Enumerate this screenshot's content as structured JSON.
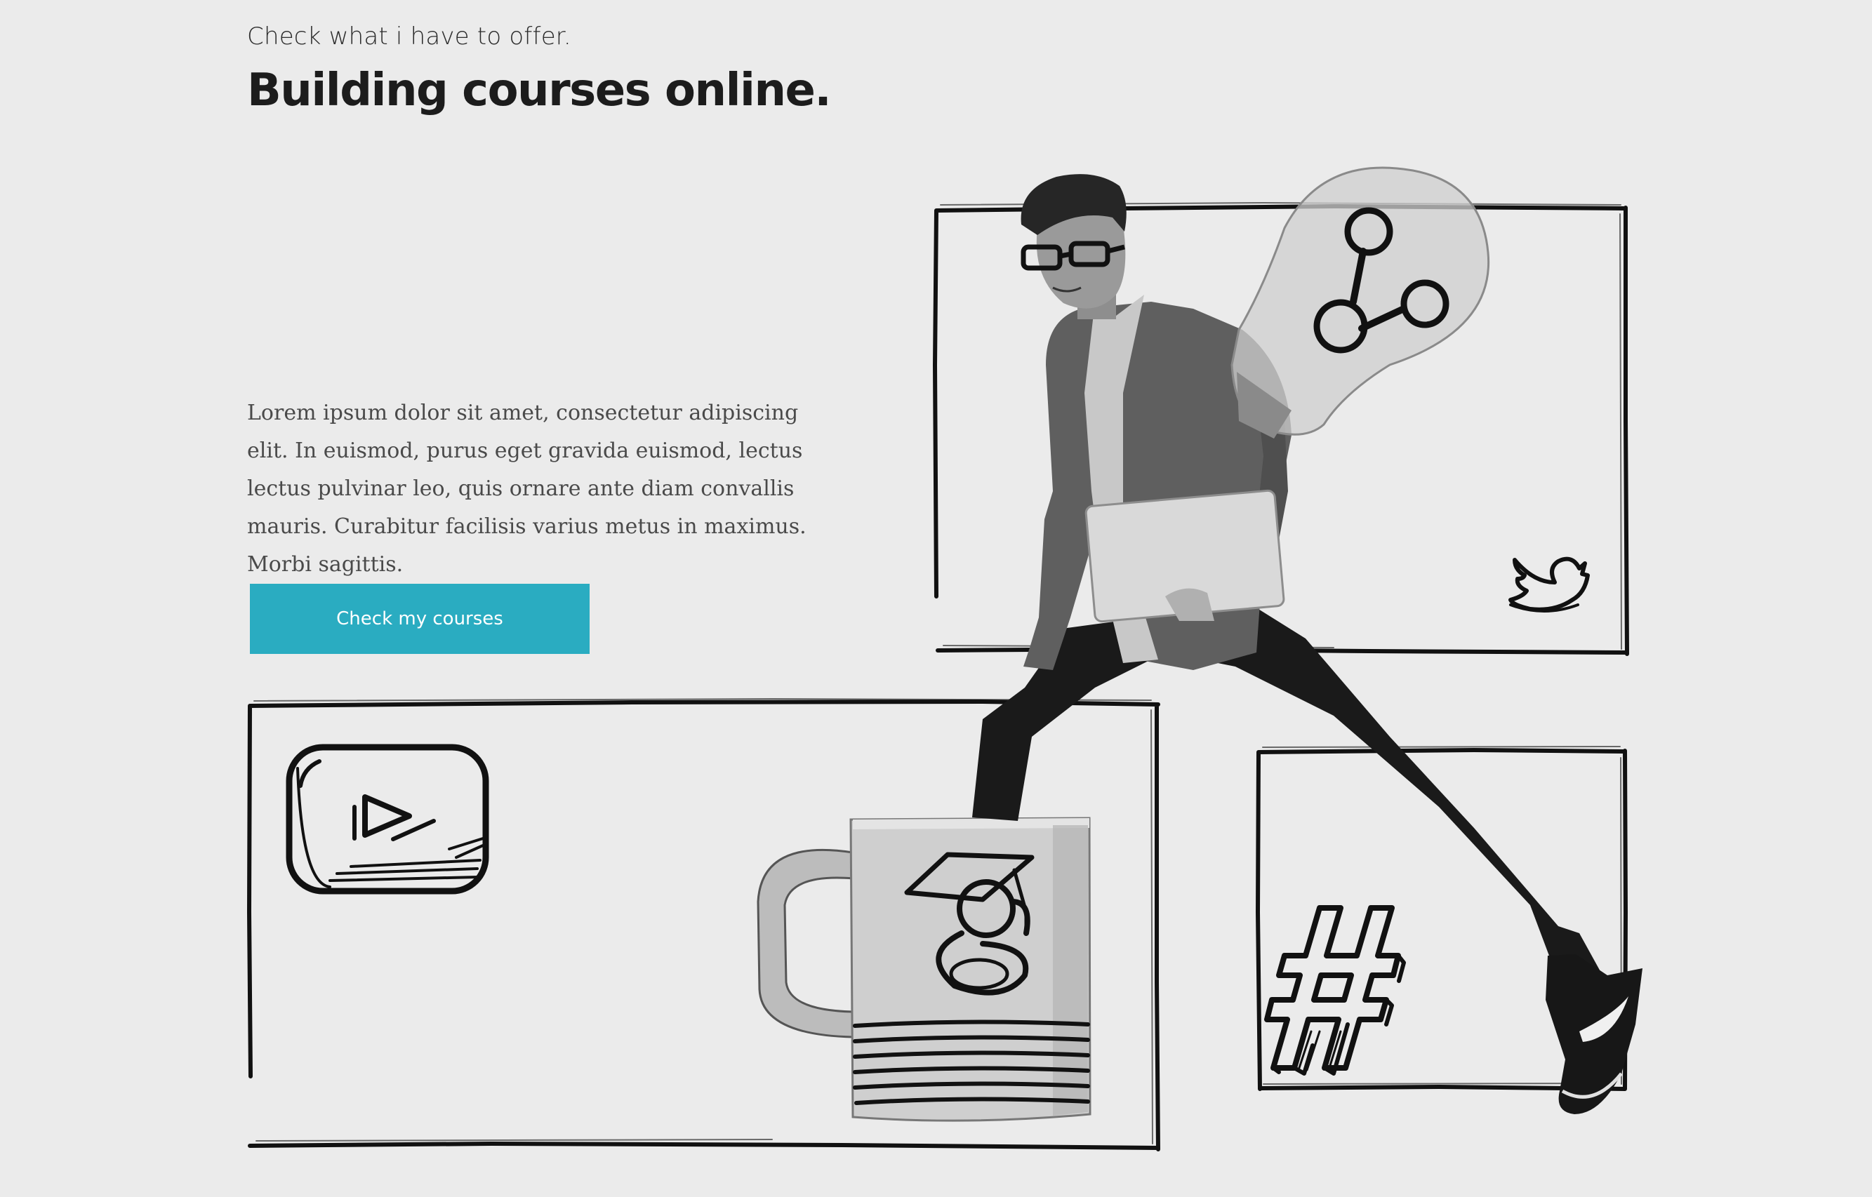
{
  "hero": {
    "eyebrow": "Check what i have to offer.",
    "title": "Building courses online.",
    "body": "Lorem ipsum dolor sit amet, consectetur adipiscing elit. In euismod, purus eget gravida euismod, lectus lectus pulvinar leo, quis ornare ante diam convallis mauris. Curabitur facilisis varius metus in maximus. Morbi sagittis.",
    "cta_label": "Check my courses"
  },
  "colors": {
    "background": "#ebebeb",
    "accent": "#2aacc1",
    "ink": "#111111"
  },
  "illustration": {
    "icons": [
      "youtube-icon",
      "twitter-bird-icon",
      "share-icon",
      "hashtag-icon",
      "google-scholar-g-icon"
    ],
    "objects": [
      "lightbulb",
      "coffee-mug",
      "laptop",
      "jumping-man"
    ]
  }
}
